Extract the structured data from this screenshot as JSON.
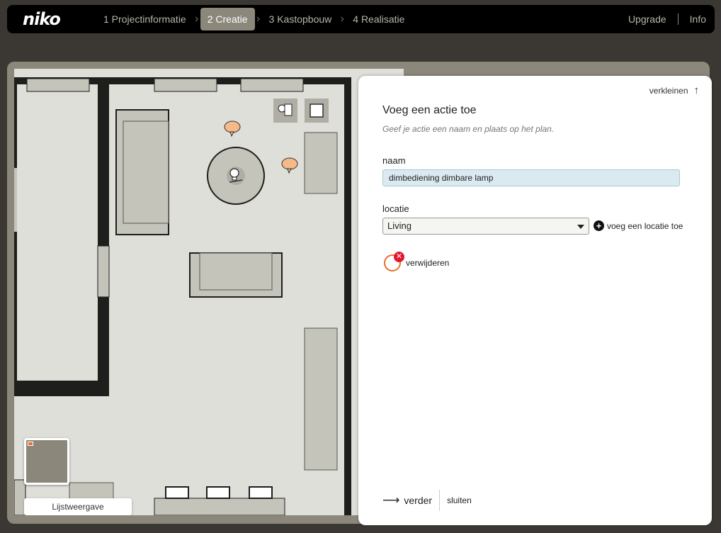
{
  "topbar": {
    "logo": "niko",
    "steps": [
      {
        "label": "1 Projectinformatie"
      },
      {
        "label": "2 Creatie"
      },
      {
        "label": "3 Kastopbouw"
      },
      {
        "label": "4 Realisatie"
      }
    ],
    "active_step": "2 Creatie",
    "upgrade": "Upgrade",
    "info": "Info"
  },
  "plan": {
    "list_view_label": "Lijstweergave"
  },
  "panel": {
    "collapse_label": "verkleinen",
    "title": "Voeg een actie toe",
    "subtitle": "Geef je actie een naam en plaats op het plan.",
    "name_label": "naam",
    "name_value": "dimbediening dimbare lamp",
    "location_label": "locatie",
    "location_value": "Living",
    "add_location_label": "voeg een locatie toe",
    "delete_label": "verwijderen",
    "next_label": "verder",
    "close_label": "sluiten"
  },
  "colors": {
    "accent_active_step": "#8c877b",
    "delete_badge": "#e0182d",
    "delete_ring": "#e8702a",
    "input_bg": "#dbeaf0"
  },
  "icons": [
    "chevron-right-icon",
    "arrow-up-icon",
    "plus-circle-icon",
    "close-icon",
    "arrow-right-icon",
    "lamp-icon",
    "switch-icon",
    "speech-bubble-icon"
  ]
}
